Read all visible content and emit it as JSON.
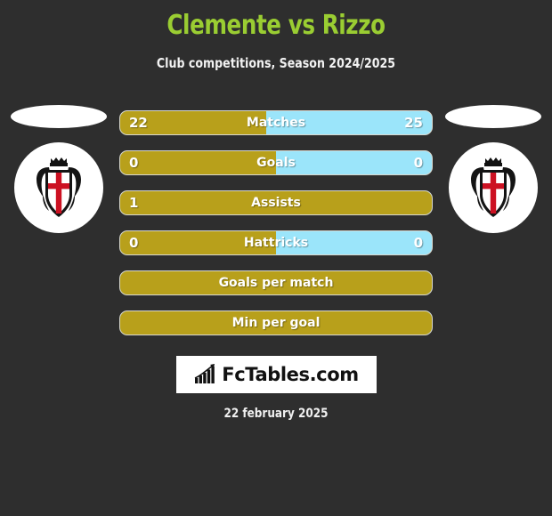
{
  "page": {
    "background_color": "#2e2e2e"
  },
  "header": {
    "title": "Clemente vs Rizzo",
    "title_color": "#9ACD32",
    "subtitle": "Club competitions, Season 2024/2025"
  },
  "teams": {
    "home": {
      "crest_icon": "club-crest-red-cross-shield-with-crown"
    },
    "away": {
      "crest_icon": "club-crest-red-cross-shield-with-crown"
    }
  },
  "colors": {
    "home_bar": "#B8A01B",
    "away_bar": "#9BE5FA",
    "accent": "#9ACD32",
    "text": "#ffffff"
  },
  "chart_data": {
    "type": "bar",
    "title": "Clemente vs Rizzo",
    "subtitle": "Club competitions, Season 2024/2025",
    "legend": [
      "Clemente",
      "Rizzo"
    ],
    "categories": [
      "Matches",
      "Goals",
      "Assists",
      "Hattricks",
      "Goals per match",
      "Min per goal"
    ],
    "series": [
      {
        "name": "Clemente",
        "values": [
          22,
          0,
          1,
          0,
          null,
          null
        ]
      },
      {
        "name": "Rizzo",
        "values": [
          25,
          0,
          null,
          0,
          null,
          null
        ]
      }
    ],
    "rows": [
      {
        "label": "Matches",
        "home": "22",
        "away": "25",
        "home_pct": 46.8
      },
      {
        "label": "Goals",
        "home": "0",
        "away": "0",
        "home_pct": 50
      },
      {
        "label": "Assists",
        "home": "1",
        "away": "",
        "home_pct": 100
      },
      {
        "label": "Hattricks",
        "home": "0",
        "away": "0",
        "home_pct": 50
      },
      {
        "label": "Goals per match",
        "home": "",
        "away": "",
        "home_pct": 100
      },
      {
        "label": "Min per goal",
        "home": "",
        "away": "",
        "home_pct": 100
      }
    ]
  },
  "footer": {
    "logo_icon": "bar-chart-growth-icon",
    "logo_text": "FcTables.com",
    "date": "22 february 2025"
  }
}
